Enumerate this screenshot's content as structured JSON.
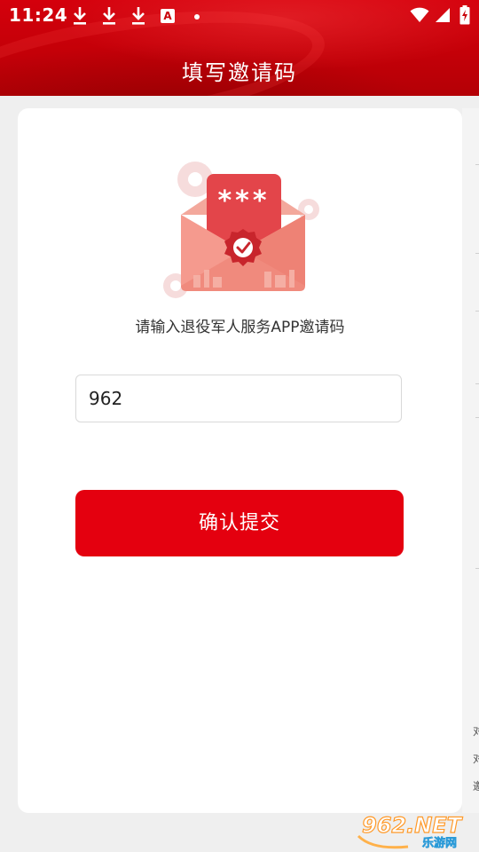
{
  "status_bar": {
    "time": "11:24",
    "notification_icons": [
      "download-icon",
      "download-icon",
      "download-icon",
      "app-a-icon",
      "dot-icon"
    ],
    "a_icon_letter": "A",
    "right_icons": [
      "wifi-icon",
      "signal-icon",
      "battery-charging-icon"
    ]
  },
  "header": {
    "title": "填写邀请码",
    "color": "#c90008"
  },
  "card": {
    "illustration": {
      "stars": "***",
      "icon": "envelope-check-icon"
    },
    "prompt": "请输入退役军人服务APP邀请码",
    "input": {
      "value": "962",
      "placeholder": ""
    },
    "submit_label": "确认提交",
    "accent_color": "#e4000f"
  },
  "background_page": {
    "glyphs": [
      "对",
      "对",
      "邀"
    ]
  },
  "watermark": {
    "logo": "962.NET",
    "subtitle": "乐游网"
  }
}
